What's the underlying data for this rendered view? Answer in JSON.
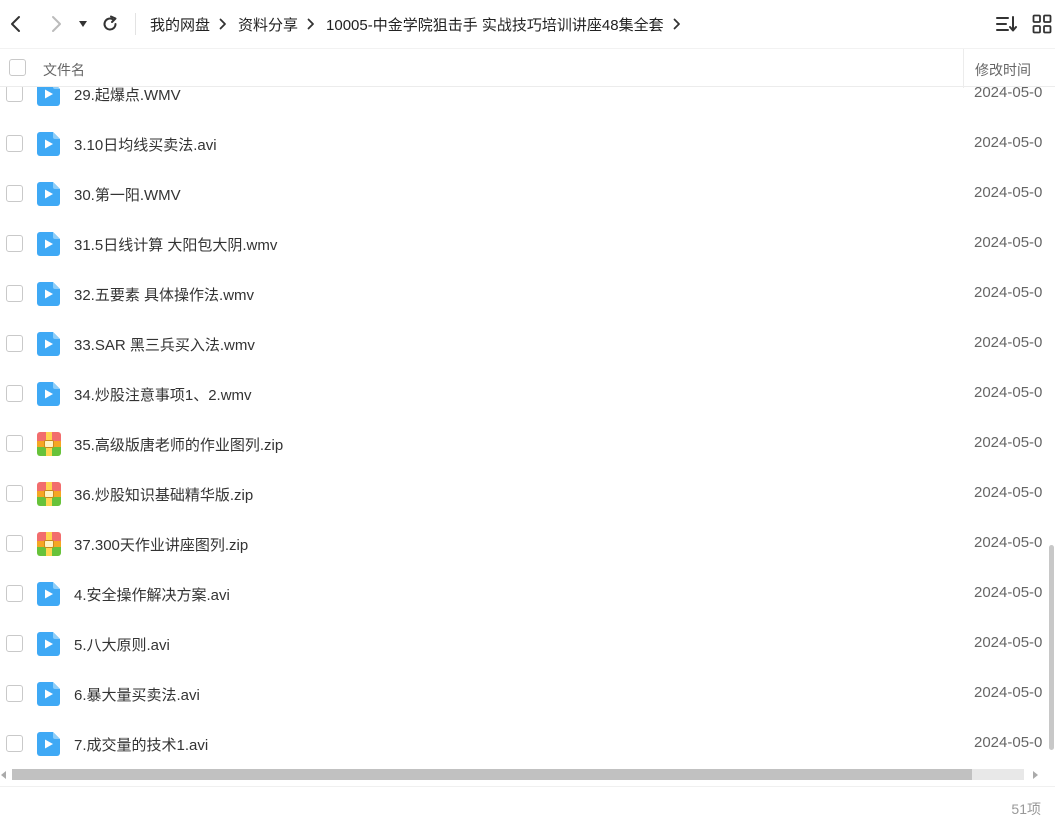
{
  "toolbar": {
    "back_icon": "chevron-left-icon",
    "forward_icon": "chevron-right-icon",
    "history_icon": "caret-down-icon",
    "refresh_icon": "refresh-icon",
    "sort_icon": "sort-list-icon",
    "view_icon": "grid-view-icon"
  },
  "breadcrumb": [
    "我的网盘",
    "资料分享",
    "10005-中金学院狙击手 实战技巧培训讲座48集全套"
  ],
  "header": {
    "name_label": "文件名",
    "time_label": "修改时间"
  },
  "files": [
    {
      "name": "29.起爆点.WMV",
      "type": "video",
      "date": "2024-05-0"
    },
    {
      "name": "3.10日均线买卖法.avi",
      "type": "video",
      "date": "2024-05-0"
    },
    {
      "name": "30.第一阳.WMV",
      "type": "video",
      "date": "2024-05-0"
    },
    {
      "name": "31.5日线计算 大阳包大阴.wmv",
      "type": "video",
      "date": "2024-05-0"
    },
    {
      "name": "32.五要素 具体操作法.wmv",
      "type": "video",
      "date": "2024-05-0"
    },
    {
      "name": "33.SAR 黑三兵买入法.wmv",
      "type": "video",
      "date": "2024-05-0"
    },
    {
      "name": "34.炒股注意事项1、2.wmv",
      "type": "video",
      "date": "2024-05-0"
    },
    {
      "name": "35.高级版唐老师的作业图列.zip",
      "type": "zip",
      "date": "2024-05-0"
    },
    {
      "name": "36.炒股知识基础精华版.zip",
      "type": "zip",
      "date": "2024-05-0"
    },
    {
      "name": "37.300天作业讲座图列.zip",
      "type": "zip",
      "date": "2024-05-0"
    },
    {
      "name": "4.安全操作解决方案.avi",
      "type": "video",
      "date": "2024-05-0"
    },
    {
      "name": "5.八大原则.avi",
      "type": "video",
      "date": "2024-05-0"
    },
    {
      "name": "6.暴大量买卖法.avi",
      "type": "video",
      "date": "2024-05-0"
    },
    {
      "name": "7.成交量的技术1.avi",
      "type": "video",
      "date": "2024-05-0"
    }
  ],
  "status": {
    "count_label": "51项"
  },
  "colors": {
    "video_icon": "#3fa9f5",
    "zip_top": "#f26d6d",
    "zip_bottom": "#67c23a",
    "zip_band": "#f5a623"
  }
}
